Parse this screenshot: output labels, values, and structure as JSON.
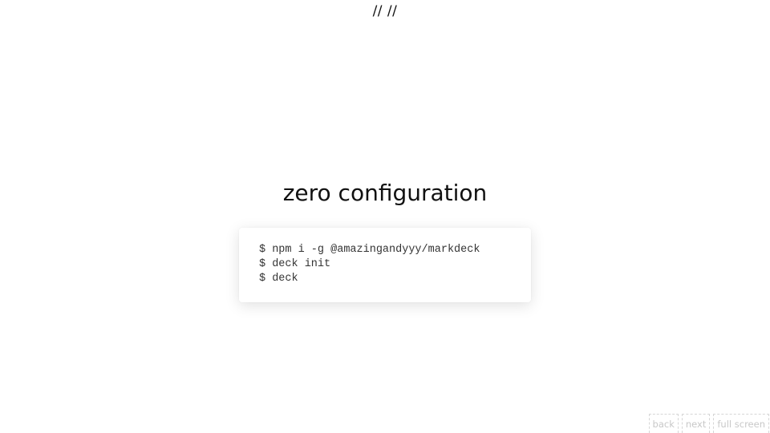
{
  "header": {
    "mark": "// //"
  },
  "slide": {
    "title": "zero configuration",
    "code_lines": [
      "$ npm i -g @amazingandyyy/markdeck",
      "$ deck init",
      "$ deck"
    ]
  },
  "controls": {
    "back_label": "back",
    "next_label": "next",
    "fullscreen_label": "full screen"
  }
}
